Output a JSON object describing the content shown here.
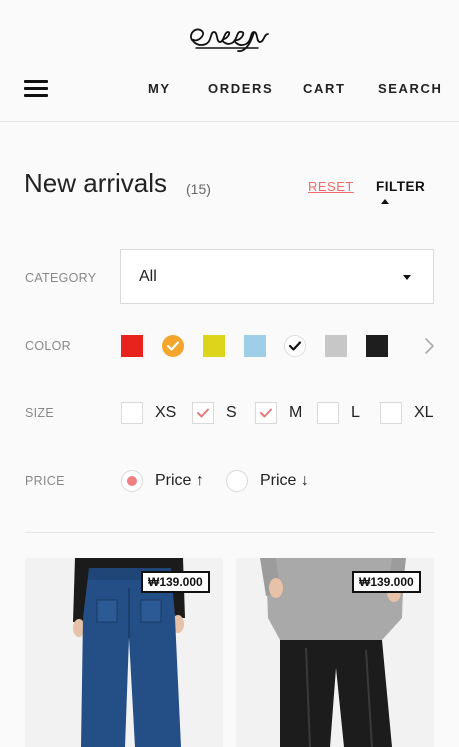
{
  "header": {
    "logo_text": "eyeye",
    "nav": [
      "MY",
      "ORDERS",
      "CART",
      "SEARCH"
    ]
  },
  "listing": {
    "title": "New arrivals",
    "count": "(15)",
    "reset_label": "RESET",
    "filter_label": "FILTER"
  },
  "filters": {
    "category": {
      "label": "CATEGORY",
      "value": "All"
    },
    "color": {
      "label": "COLOR",
      "swatches": [
        {
          "name": "red",
          "hex": "#e8221c",
          "selected": false
        },
        {
          "name": "orange",
          "hex": "#f4a52b",
          "selected": true
        },
        {
          "name": "yellow",
          "hex": "#dcd51c",
          "selected": false
        },
        {
          "name": "light-blue",
          "hex": "#9fcfe8",
          "selected": false
        },
        {
          "name": "white",
          "hex": "#ffffff",
          "selected": true
        },
        {
          "name": "grey",
          "hex": "#c7c7c7",
          "selected": false
        },
        {
          "name": "black",
          "hex": "#1e1e1e",
          "selected": false
        }
      ]
    },
    "size": {
      "label": "SIZE",
      "options": [
        {
          "label": "XS",
          "checked": false
        },
        {
          "label": "S",
          "checked": true
        },
        {
          "label": "M",
          "checked": true
        },
        {
          "label": "L",
          "checked": false
        },
        {
          "label": "XL",
          "checked": false
        }
      ]
    },
    "price": {
      "label": "PRICE",
      "options": [
        {
          "label": "Price ↑",
          "selected": true
        },
        {
          "label": "Price ↓",
          "selected": false
        }
      ]
    }
  },
  "products": [
    {
      "price": "₩139.000",
      "image": "blue-wide-jeans-photo"
    },
    {
      "price": "₩139.000",
      "image": "grey-coat-black-pants-photo"
    }
  ],
  "colors": {
    "accent": "#ef6b6b",
    "check": "#e27a7a"
  }
}
